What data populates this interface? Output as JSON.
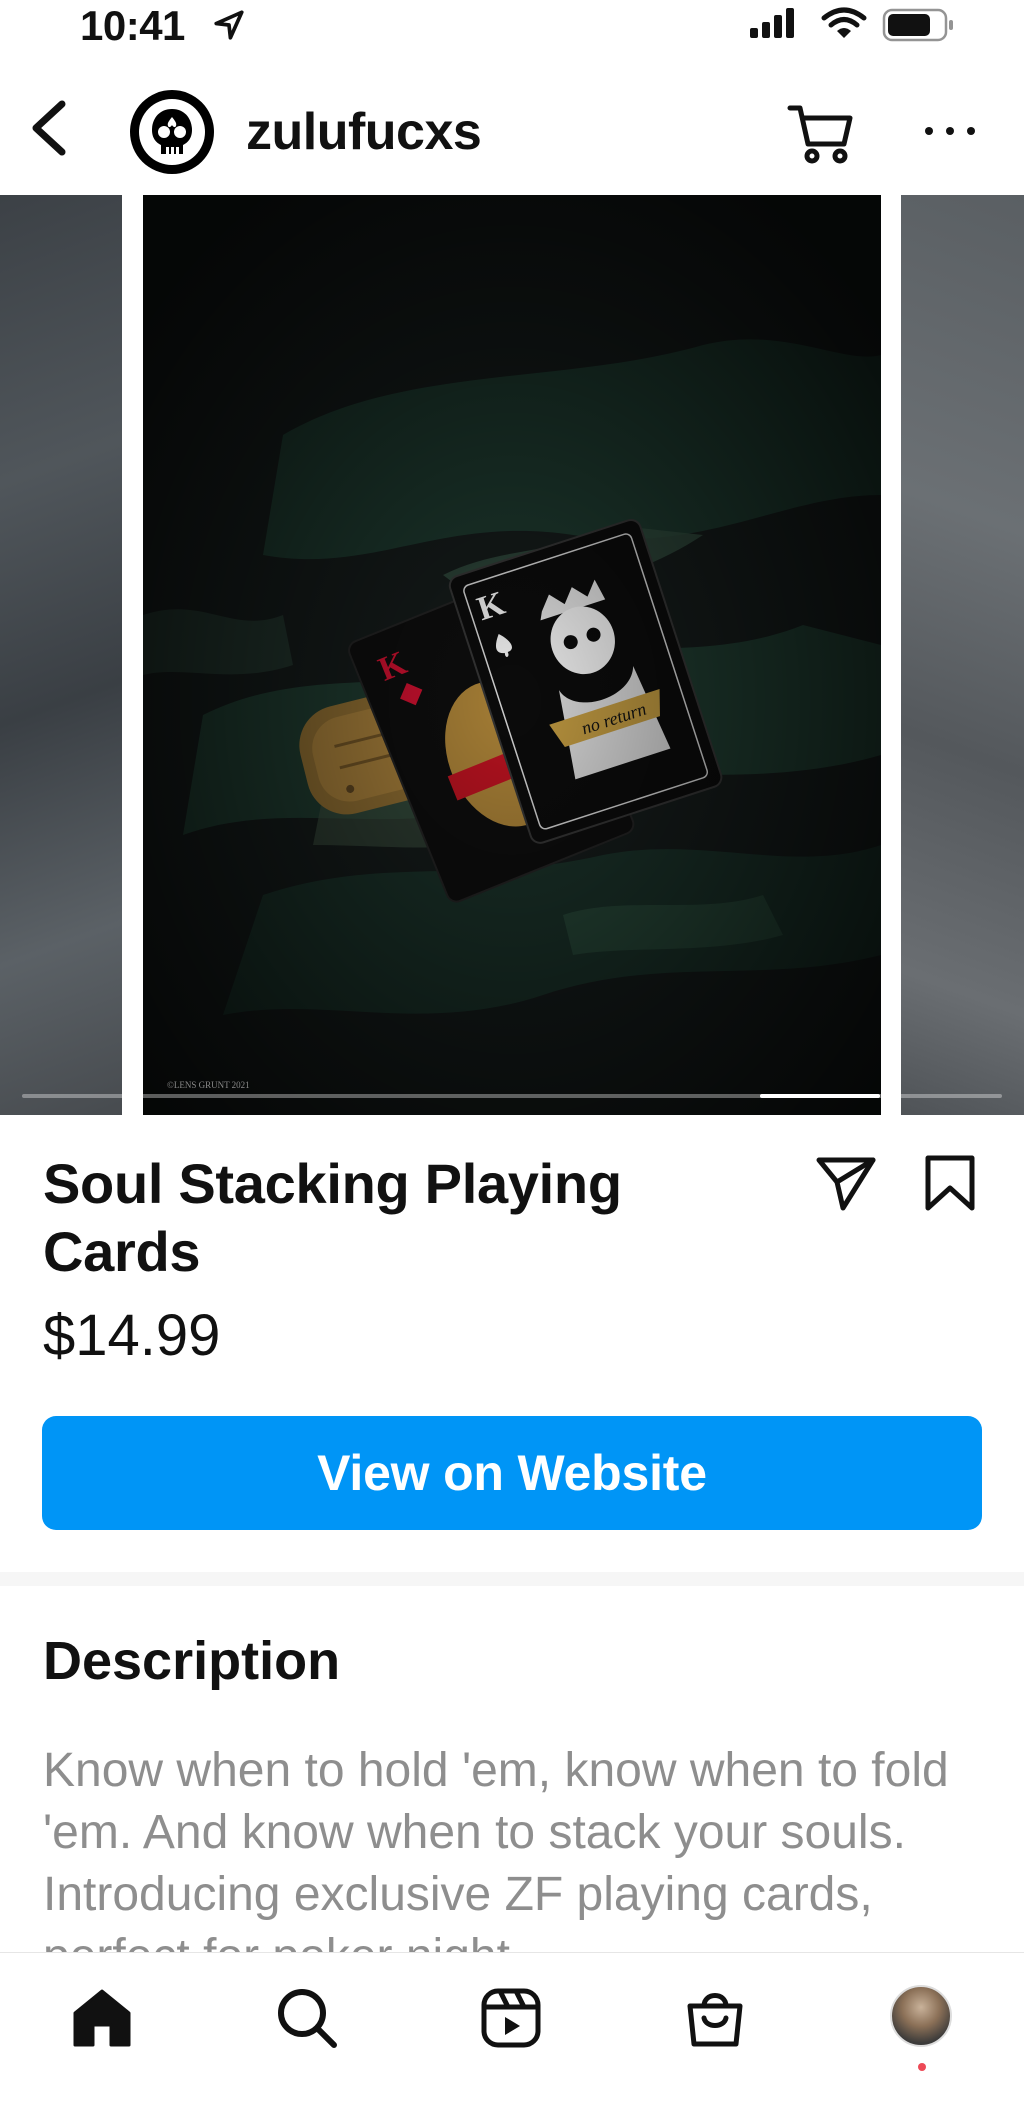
{
  "status_bar": {
    "time": "10:41",
    "icons": [
      "location-arrow-icon",
      "cellular-signal-icon",
      "wifi-icon",
      "battery-icon"
    ]
  },
  "header": {
    "username": "zulufucxs",
    "icons": [
      "back-chevron-icon",
      "cart-icon",
      "more-icon"
    ]
  },
  "carousel": {
    "watermark": "©LENS GRUNT 2021",
    "progress": 0.85
  },
  "product": {
    "title": "Soul Stacking Playing Cards",
    "price": "$14.99",
    "cta_label": "View on Website"
  },
  "description": {
    "heading": "Description",
    "body": "Know when to hold 'em, know when to fold 'em. And know when to stack your souls. Introducing exclusive ZF playing cards, perfect for poker night."
  },
  "bottom_nav": {
    "items": [
      "home-icon",
      "search-icon",
      "reels-icon",
      "shop-icon",
      "profile-avatar"
    ]
  },
  "colors": {
    "accent": "#0095f6",
    "notification_dot": "#ed4956",
    "description_text": "#8e8e8e"
  }
}
